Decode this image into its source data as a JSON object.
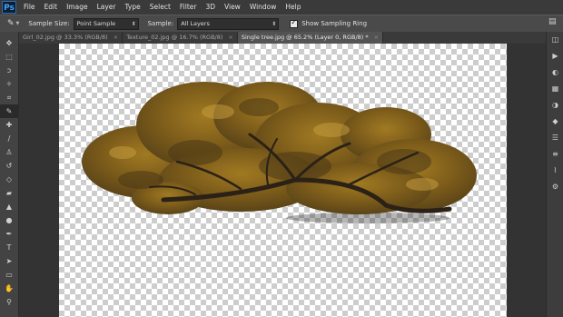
{
  "app": {
    "logo": "Ps"
  },
  "menu": [
    "File",
    "Edit",
    "Image",
    "Layer",
    "Type",
    "Select",
    "Filter",
    "3D",
    "View",
    "Window",
    "Help"
  ],
  "options": {
    "tool_icon": "eyedropper-icon",
    "sample_size_label": "Sample Size:",
    "sample_size_value": "Point Sample",
    "sample_label": "Sample:",
    "sample_value": "All Layers",
    "show_ring_label": "Show Sampling Ring",
    "show_ring_checked": true
  },
  "tabs": [
    {
      "label": "Girl_02.jpg @ 33.3% (RGB/8)",
      "close": "×"
    },
    {
      "label": "Texture_02.jpg @ 16.7% (RGB/8)",
      "close": "×"
    },
    {
      "label": "Single tree.jpg @ 65.2% (Layer 0, RGB/8) *",
      "close": "×"
    }
  ],
  "tools": [
    "move-icon",
    "marquee-icon",
    "lasso-icon",
    "quick-select-icon",
    "crop-icon",
    "eyedropper-icon",
    "healing-brush-icon",
    "brush-icon",
    "clone-stamp-icon",
    "history-brush-icon",
    "eraser-icon",
    "paint-bucket-icon",
    "blur-icon",
    "dodge-icon",
    "pen-icon",
    "type-icon",
    "path-select-icon",
    "rectangle-icon",
    "hand-icon",
    "zoom-icon"
  ],
  "panel_icons": [
    "history-icon",
    "actions-icon",
    "color-icon",
    "swatches-icon",
    "adjustments-icon",
    "styles-icon",
    "layers-icon",
    "channels-icon",
    "paths-icon",
    "properties-icon"
  ],
  "colors": {
    "menubar": "#3a3a3a",
    "workspace": "#333333",
    "foliage": "#8b6a1e"
  }
}
